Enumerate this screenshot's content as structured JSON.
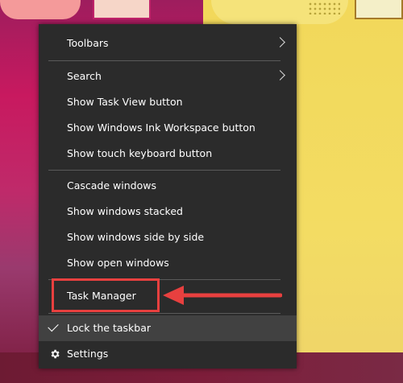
{
  "menu": {
    "items": [
      {
        "label": "Toolbars",
        "has_submenu": true
      },
      {
        "label": "Search",
        "has_submenu": true
      },
      {
        "label": "Show Task View button"
      },
      {
        "label": "Show Windows Ink Workspace button"
      },
      {
        "label": "Show touch keyboard button"
      },
      {
        "label": "Cascade windows"
      },
      {
        "label": "Show windows stacked"
      },
      {
        "label": "Show windows side by side"
      },
      {
        "label": "Show open windows"
      },
      {
        "label": "Task Manager",
        "highlighted": true
      },
      {
        "label": "Lock the taskbar",
        "checked": true
      },
      {
        "label": "Settings",
        "icon": "gear-icon"
      }
    ]
  },
  "annotation": {
    "highlight_color": "#e8403f",
    "arrow_color": "#e8403f"
  },
  "colors": {
    "menu_bg": "#2b2b2b",
    "menu_hover": "#414141",
    "menu_text": "#ffffff"
  }
}
